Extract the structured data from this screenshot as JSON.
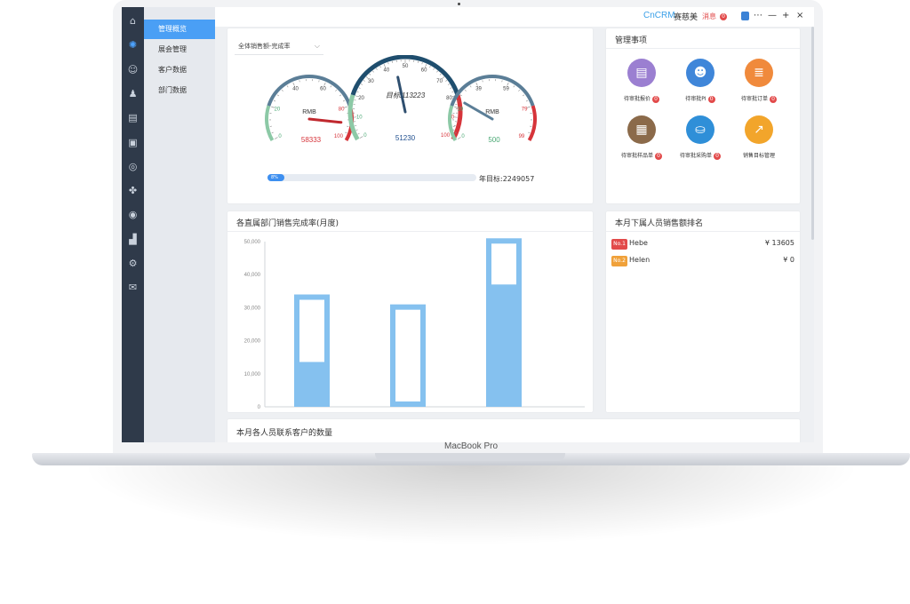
{
  "device": {
    "label": "MacBook Pro"
  },
  "topbar": {
    "brand": "CnCRM",
    "user": "赛慈美",
    "messages_label": "消息",
    "messages_count": "0",
    "icons": [
      "badge-icon",
      "more-icon",
      "minimize-icon",
      "maximize-icon",
      "close-icon"
    ]
  },
  "rail": {
    "icons": [
      "home-icon",
      "gear-cluster-icon",
      "users-icon",
      "person-run-icon",
      "document-icon",
      "clipboard-icon",
      "target-icon",
      "apps-icon",
      "location-icon",
      "bar-chart-icon",
      "settings-icon",
      "mail-icon"
    ],
    "active_index": 1
  },
  "submenu": {
    "items": [
      "管理概览",
      "展会管理",
      "客户数据",
      "部门数据"
    ],
    "active_index": 0
  },
  "sales": {
    "select_value": "全体销售额-完成率",
    "gauges": [
      {
        "unit": "RMB",
        "ticks": [
          "0",
          "20",
          "40",
          "60",
          "80",
          "100"
        ],
        "value_text": "58333",
        "needle_fraction": 0.9,
        "color": "#5b7e97"
      },
      {
        "unit": "目标:113223",
        "ticks": [
          "0",
          "10",
          "20",
          "30",
          "40",
          "50",
          "60",
          "70",
          "80",
          "90",
          "100"
        ],
        "value_text": "51230",
        "needle_fraction": 0.45,
        "color": "#1f4e6e"
      },
      {
        "unit": "RMB",
        "ticks": [
          "0",
          "19",
          "39",
          "59",
          "79",
          "99"
        ],
        "value_text": "500",
        "needle_fraction": 0.25,
        "color": "#5b7e97"
      }
    ],
    "progress_percent": 8,
    "progress_label": "8%",
    "target_label": "年目标:2249057"
  },
  "todos": {
    "title": "管理事项",
    "items": [
      {
        "label": "待审批报价",
        "badge": "0",
        "color": "#9b7fd1",
        "icon": "clipboard-icon"
      },
      {
        "label": "待审批PI",
        "badge": "0",
        "color": "#3f86d9",
        "icon": "person-icon"
      },
      {
        "label": "待审批订单",
        "badge": "0",
        "color": "#f08a3c",
        "icon": "list-icon"
      },
      {
        "label": "待审批样品单",
        "badge": "0",
        "color": "#8b6a4a",
        "icon": "box-icon"
      },
      {
        "label": "待审批采购单",
        "badge": "0",
        "color": "#2f8fd8",
        "icon": "basket-icon"
      },
      {
        "label": "销售目标管理",
        "badge": "",
        "color": "#f2a52b",
        "icon": "trend-icon"
      }
    ]
  },
  "dept_chart": {
    "title": "各直属部门销售完成率(月度)"
  },
  "chart_data": {
    "type": "bar",
    "title": "各直属部门销售完成率(月度)",
    "xlabel": "",
    "ylabel": "",
    "ylim": [
      0,
      50000
    ],
    "ticks": [
      "0",
      "10,000",
      "20,000",
      "30,000",
      "40,000",
      "50,000"
    ],
    "categories": [
      "",
      "",
      ""
    ],
    "series": [
      {
        "values": [
          34000,
          31000,
          51000
        ]
      },
      {
        "values": [
          13500,
          31000,
          38000
        ]
      }
    ],
    "grid": false
  },
  "ranking": {
    "title": "本月下属人员销售额排名",
    "rows": [
      {
        "tag": "No.1",
        "name": "Hebe",
        "amount": "¥  13605",
        "color": "#e24a4a"
      },
      {
        "tag": "No.2",
        "name": "Helen",
        "amount": "¥  0",
        "color": "#f0a13a"
      }
    ]
  },
  "contacts": {
    "title": "本月各人员联系客户的数量"
  }
}
